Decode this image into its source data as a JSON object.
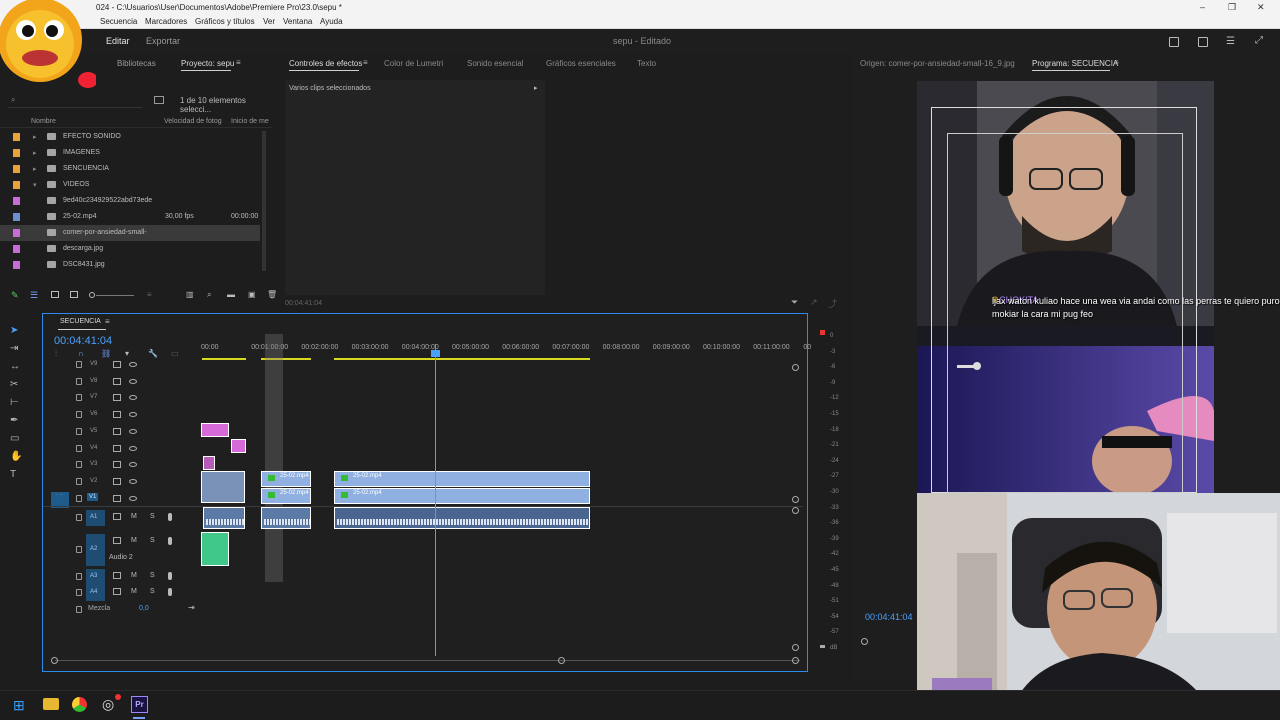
{
  "window": {
    "title": "024 - C:\\Usuarios\\User\\Documentos\\Adobe\\Premiere Pro\\23.0\\sepu *",
    "controls": [
      "–",
      "❐",
      "✕"
    ]
  },
  "menubar": [
    "Secuencia",
    "Marcadores",
    "Gráficos y títulos",
    "Ver",
    "Ventana",
    "Ayuda"
  ],
  "workspace": {
    "tabs": [
      "Editar",
      "Exportar"
    ],
    "active_tab": "Editar",
    "doc_title": "sepu - Editado"
  },
  "project": {
    "tabs": [
      "Bibliotecas",
      "Proyecto: sepu"
    ],
    "count": "1 de 10 elementos selecci...",
    "columns": {
      "name": "Nombre",
      "fps": "Velocidad de fotog",
      "start": "Inicio de me"
    },
    "items": [
      {
        "name": "EFECTO SONIDO",
        "color": "#e8a23a",
        "folder": true,
        "fps": "",
        "start": ""
      },
      {
        "name": "IMAGENES",
        "color": "#e8a23a",
        "folder": true,
        "fps": "",
        "start": ""
      },
      {
        "name": "SENCUENCIA",
        "color": "#e8a23a",
        "folder": true,
        "fps": "",
        "start": ""
      },
      {
        "name": "VIDEOS",
        "color": "#e8a23a",
        "folder": true,
        "fps": "",
        "start": ""
      },
      {
        "name": "9ed40c234929522abd73ede",
        "color": "#c86ad8",
        "folder": false,
        "fps": "",
        "start": ""
      },
      {
        "name": "25-02.mp4",
        "color": "#6a8fd0",
        "folder": false,
        "fps": "30,00 fps",
        "start": "00:00:00"
      },
      {
        "name": "comer-por-ansiedad-small-",
        "color": "#c86ad8",
        "folder": false,
        "fps": "",
        "start": ""
      },
      {
        "name": "descarga.jpg",
        "color": "#c86ad8",
        "folder": false,
        "fps": "",
        "start": ""
      },
      {
        "name": "DSC8431.jpg",
        "color": "#c86ad8",
        "folder": false,
        "fps": "",
        "start": ""
      }
    ]
  },
  "effects": {
    "tabs": [
      "Controles de efectos",
      "Color de Lumetri",
      "Sonido esencial",
      "Gráficos esenciales",
      "Texto"
    ],
    "active_tab": "Controles de efectos",
    "subheader": "Varios clips seleccionados",
    "timecode": "00:04:41:04"
  },
  "timeline": {
    "title": "SECUENCIA",
    "timecode": "00:04:41:04",
    "ruler": [
      "00:00",
      "00:01:00:00",
      "00:02:00:00",
      "00:03:00:00",
      "00:04:00:00",
      "00:05:00:00",
      "00:06:00:00",
      "00:07:00:00",
      "00:08:00:00",
      "00:09:00:00",
      "00:10:00:00",
      "00:11:00:00",
      "00"
    ],
    "video_tracks": [
      "V9",
      "V8",
      "V7",
      "V6",
      "V5",
      "V4",
      "V3",
      "V2",
      "V1"
    ],
    "audio_tracks": [
      "A1",
      "A2",
      "A3",
      "A4"
    ],
    "audio2_label": "Audio 2",
    "mix_label": "Mezcla",
    "mix_value": "0,0",
    "clip_label": "25-02.mp4",
    "meter_scale": [
      "0",
      "-3",
      "-6",
      "-9",
      "-12",
      "-15",
      "-18",
      "-21",
      "-24",
      "-27",
      "-30",
      "-33",
      "-36",
      "-39",
      "-42",
      "-45",
      "-48",
      "-51",
      "-54",
      "-57",
      "dB"
    ]
  },
  "monitor": {
    "source_tab": "Origen: comer-por-ansiedad-small-16_9.jpg",
    "program_tab": "Programa: SECUENCIA",
    "timecode": "00:04:41:04",
    "chat_user": "CHOKITA:",
    "chat_text": "ijax waton kuliao hace una wea via andai como las perras te quiero puro mokiar la cara mi pug feo"
  },
  "colors": {
    "accent": "#2d8ceb",
    "clip_video": "#8fb0e0",
    "clip_pink": "#d66ad8",
    "clip_green": "#3fc88a"
  }
}
